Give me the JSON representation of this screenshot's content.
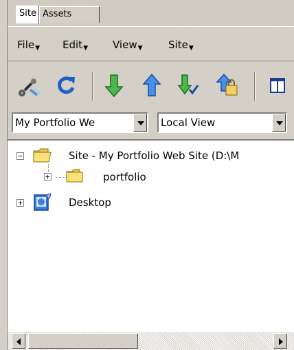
{
  "tabs": [
    {
      "label": "Site"
    },
    {
      "label": "Assets"
    }
  ],
  "menu": [
    {
      "label": "File"
    },
    {
      "label": "Edit"
    },
    {
      "label": "View"
    },
    {
      "label": "Site"
    }
  ],
  "toolbar": {
    "icons": [
      "connect-icon",
      "refresh-icon",
      "get-files-icon",
      "put-files-icon",
      "check-out-icon",
      "check-in-icon",
      "expand-panel-icon"
    ]
  },
  "site_select": {
    "value": "My Portfolio We"
  },
  "view_select": {
    "value": "Local View"
  },
  "tree": [
    {
      "label": "Site - My Portfolio Web Site (D:\\M"
    },
    {
      "label": "portfolio"
    },
    {
      "label": "Desktop"
    }
  ],
  "colors": {
    "chrome": "#d4d0c8",
    "folder": "#f7e37a",
    "green_arrow": "#3aa33a",
    "blue_arrow": "#2f6fd0"
  }
}
